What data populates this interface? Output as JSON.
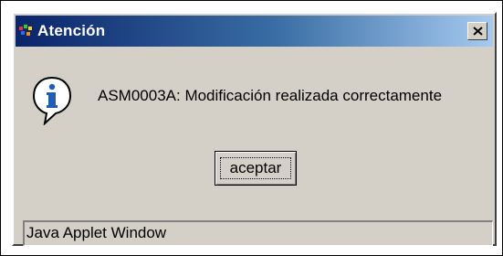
{
  "dialog": {
    "title": "Atención",
    "message": "ASM0003A: Modificación realizada correctamente",
    "icon": "info-icon",
    "buttons": {
      "accept_label": "aceptar",
      "close_icon": "close-icon"
    },
    "status_bar": {
      "text": "Java Applet Window"
    }
  },
  "colors": {
    "title_bar_start": "#0a246a",
    "title_bar_end": "#a6caf0",
    "dialog_background": "#d4d0c8",
    "info_icon_fill": "#1e5eb8"
  }
}
